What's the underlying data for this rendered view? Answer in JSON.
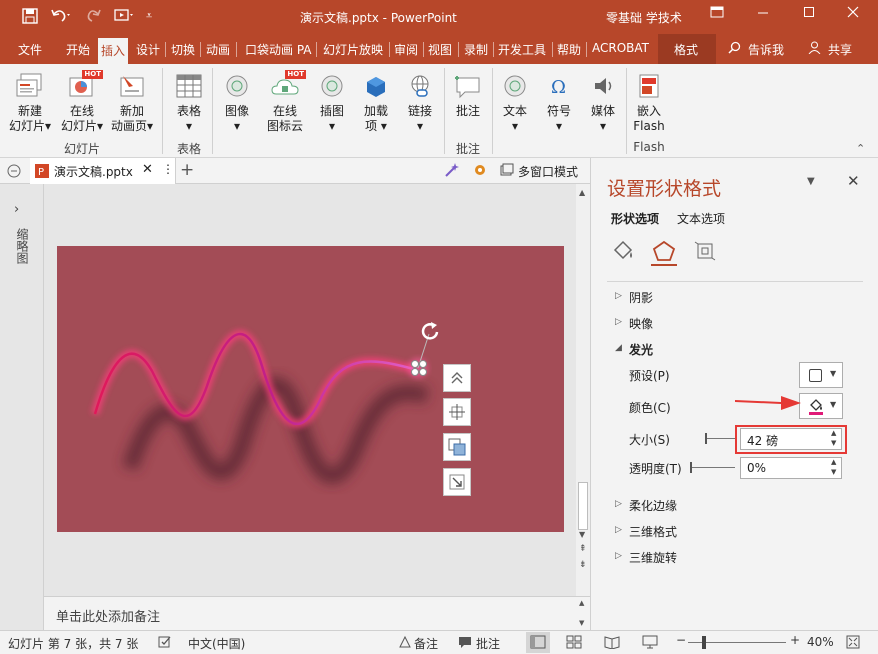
{
  "titlebar": {
    "title": "演示文稿.pptx  -  PowerPoint",
    "user": "零基础 学技术",
    "undo_icon": "undo-icon",
    "colors": {
      "brand": "#b7472a"
    }
  },
  "tabs": [
    "文件",
    "开始",
    "插入",
    "设计",
    "切换",
    "动画",
    "口袋动画 PA",
    "幻灯片放映",
    "审阅",
    "视图",
    "录制",
    "开发工具",
    "帮助",
    "ACROBAT",
    "格式"
  ],
  "tell_me": "告诉我",
  "share": "共享",
  "ribbon": {
    "buttons": [
      {
        "l1": "新建",
        "l2": "幻灯片▾"
      },
      {
        "l1": "在线",
        "l2": "幻灯片▾",
        "hot": "HOT"
      },
      {
        "l1": "新加",
        "l2": "动画页▾"
      },
      {
        "l1": "表格",
        "l2": "▾"
      },
      {
        "l1": "图像",
        "l2": "▾"
      },
      {
        "l1": "在线",
        "l2": "图标云",
        "hot": "HOT"
      },
      {
        "l1": "插图",
        "l2": "▾"
      },
      {
        "l1": "加载",
        "l2": "项 ▾"
      },
      {
        "l1": "链接",
        "l2": "▾"
      },
      {
        "l1": "批注",
        "l2": ""
      },
      {
        "l1": "文本",
        "l2": "▾"
      },
      {
        "l1": "符号",
        "l2": "▾"
      },
      {
        "l1": "媒体",
        "l2": "▾"
      },
      {
        "l1": "嵌入",
        "l2": "Flash"
      }
    ],
    "groups": [
      "幻灯片",
      "表格",
      "批注",
      "Flash"
    ]
  },
  "doctab": {
    "name": "演示文稿.pptx",
    "multiwindow": "多窗口模式"
  },
  "leftpanel": {
    "label": "缩略图"
  },
  "notes": {
    "placeholder": "单击此处添加备注"
  },
  "pane": {
    "title": "设置形状格式",
    "tabs": [
      "形状选项",
      "文本选项"
    ],
    "sections": {
      "shadow": "阴影",
      "reflection": "映像",
      "glow": "发光",
      "soft_edges": "柔化边缘",
      "format3d": "三维格式",
      "rotation3d": "三维旋转"
    },
    "glow": {
      "preset": "预设(P)",
      "color": "颜色(C)",
      "size_label": "大小(S)",
      "size_value": "42 磅",
      "transparency_label": "透明度(T)",
      "transparency_value": "0%"
    }
  },
  "status": {
    "slide": "幻灯片 第 7 张，共 7 张",
    "lang": "中文(中国)",
    "notes": "备注",
    "comments": "批注",
    "zoom": "40%"
  }
}
